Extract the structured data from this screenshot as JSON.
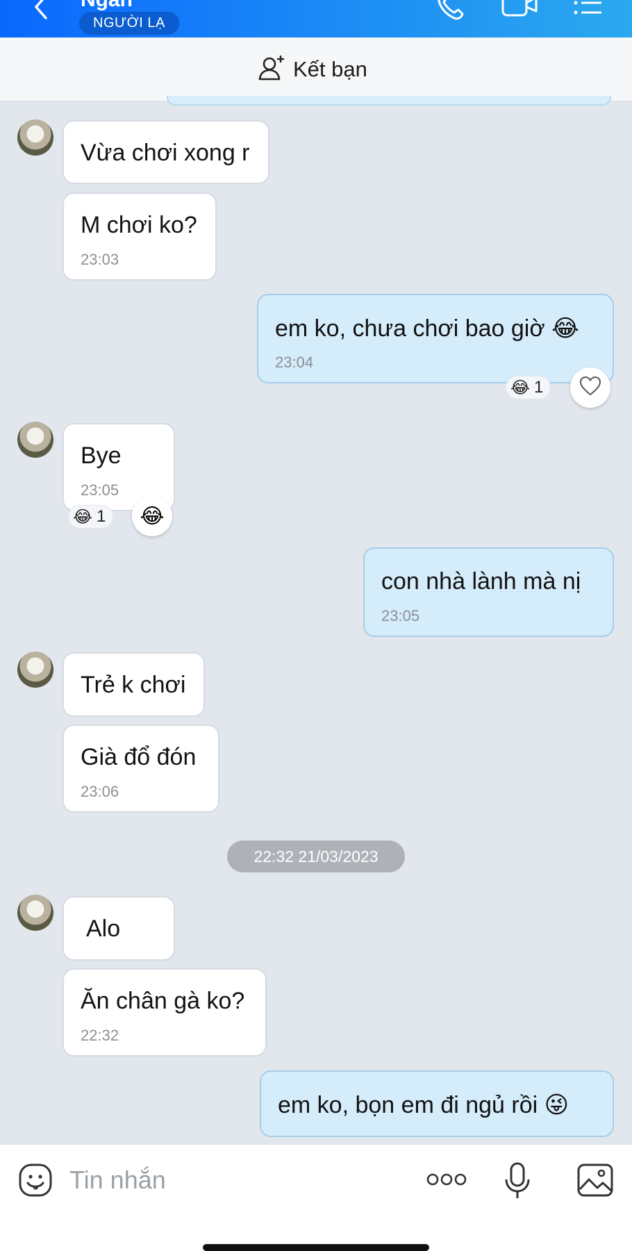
{
  "header": {
    "contact_name": "Ngân",
    "badge": "NGƯỜI LẠ",
    "icons": [
      "back-chevron-icon",
      "phone-icon",
      "video-call-icon",
      "menu-list-icon"
    ],
    "background_gradient": [
      "#0a68ff",
      "#2ba8ee"
    ]
  },
  "friend_bar": {
    "label": "Kết bạn",
    "icon": "add-friend-icon"
  },
  "messages": [
    {
      "side": "in",
      "text": "Vừa chơi xong r"
    },
    {
      "side": "in",
      "text": "M chơi ko?",
      "time": "23:03"
    },
    {
      "side": "out",
      "text": "em ko, chưa chơi bao giờ 😂",
      "time": "23:04",
      "reaction": "😂",
      "reaction_count": "1"
    },
    {
      "side": "in",
      "text": "Bye",
      "time": "23:05",
      "reaction": "😂",
      "reaction_count": "1"
    },
    {
      "side": "out",
      "text": "con nhà lành mà nị",
      "time": "23:05"
    },
    {
      "side": "in",
      "text": "Trẻ k chơi"
    },
    {
      "side": "in",
      "text": "Già đổ đón",
      "time": "23:06"
    },
    {
      "side": "in",
      "text": "Alo"
    },
    {
      "side": "in",
      "text": "Ăn chân gà ko?",
      "time": "22:32"
    },
    {
      "side": "out",
      "text": "em ko, bọn em đi ngủ rồi 😜"
    }
  ],
  "date_separator": "22:32 21/03/2023",
  "composer": {
    "placeholder": "Tin nhắn",
    "icons": [
      "sticker-icon",
      "more-options-icon",
      "microphone-icon",
      "image-icon"
    ]
  },
  "colors": {
    "incoming_bubble": "#ffffff",
    "outgoing_bubble": "#d5ecfb",
    "chat_background": "#e2e7ee"
  }
}
